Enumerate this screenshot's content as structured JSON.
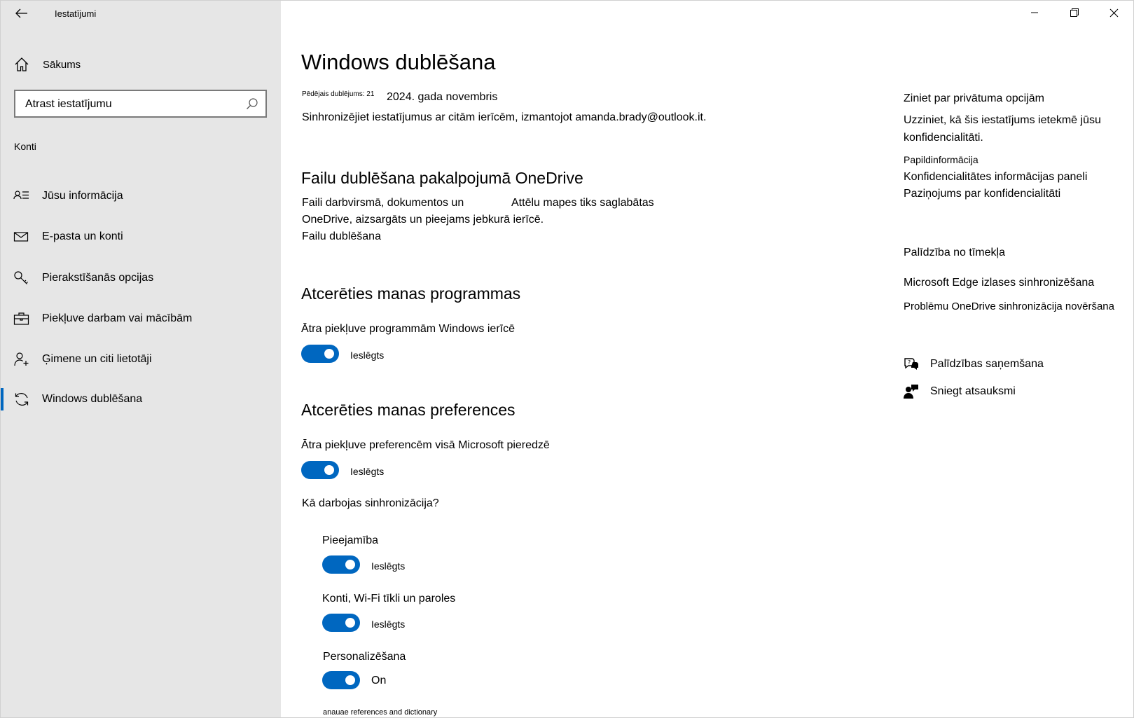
{
  "window": {
    "title": "Iestatījumi"
  },
  "sidebar": {
    "home_label": "Sākums",
    "search_placeholder": "Atrast iestatījumu",
    "section_label": "Konti",
    "items": [
      {
        "label": "Jūsu informācija",
        "icon": "person-card-icon"
      },
      {
        "label": "E-pasta un konti",
        "icon": "mail-icon"
      },
      {
        "label": "Pierakstīšanās opcijas",
        "icon": "key-icon"
      },
      {
        "label": "Piekļuve darbam vai mācībām",
        "icon": "briefcase-icon"
      },
      {
        "label": "Ģimene un citi lietotāji",
        "icon": "add-person-icon"
      },
      {
        "label": "Windows dublēšana",
        "icon": "sync-icon",
        "active": true
      }
    ]
  },
  "main": {
    "title": "Windows dublēšana",
    "last_backup_label": "Pēdējais dublējums: 21",
    "last_backup_date": "2024. gada novembris",
    "sync_description": "Sinhronizējiet iestatījumus ar citām ierīcēm, izmantojot amanda.brady@outlook.it.",
    "onedrive": {
      "heading": "Failu dublēšana pakalpojumā OneDrive",
      "line1a": "Faili darbvirsmā, dokumentos un",
      "line1b": "Attēlu mapes tiks saglabātas",
      "line2": "OneDrive, aizsargāts un pieejams jebkurā ierīcē.",
      "link": "Failu dublēšana"
    },
    "apps": {
      "heading": "Atcerēties manas programmas",
      "description": "Ātra piekļuve programmām Windows ierīcē",
      "toggle_label": "Ieslēgts",
      "toggle_on": true
    },
    "preferences": {
      "heading": "Atcerēties manas preferences",
      "description": "Ātra piekļuve preferencēm visā Microsoft pieredzē",
      "toggle_label": "Ieslēgts",
      "toggle_on": true,
      "how_link": "Kā darbojas sinhronizācija?",
      "sub": [
        {
          "label": "Pieejamība",
          "toggle_label": "Ieslēgts",
          "on": true
        },
        {
          "label": "Konti, Wi-Fi tīkli un paroles",
          "toggle_label": "Ieslēgts",
          "on": true
        },
        {
          "label": "Personalizēšana",
          "toggle_label": "On",
          "on": true
        }
      ],
      "cut_off_text": "anauae references and dictionary"
    }
  },
  "right": {
    "privacy_heading": "Ziniet par privātuma opcijām",
    "privacy_text_line1": "Uzziniet, kā šis iestatījums ietekmē jūsu",
    "privacy_text_line2": "konfidencialitāti.",
    "more_info": "Papildinformācija",
    "dashboard_link": "Konfidencialitātes informācijas paneli",
    "statement_link": "Paziņojums par konfidencialitāti",
    "web_help_heading": "Palīdzība no tīmekļa",
    "edge_link": "Microsoft Edge izlases sinhronizēšana",
    "onedrive_link": "Problēmu OneDrive sinhronizācija novēršana",
    "get_help": "Palīdzības saņemšana",
    "feedback": "Sniegt atsauksmi"
  },
  "colors": {
    "accent": "#0067c0",
    "sidebar_bg": "#e6e6e6"
  }
}
